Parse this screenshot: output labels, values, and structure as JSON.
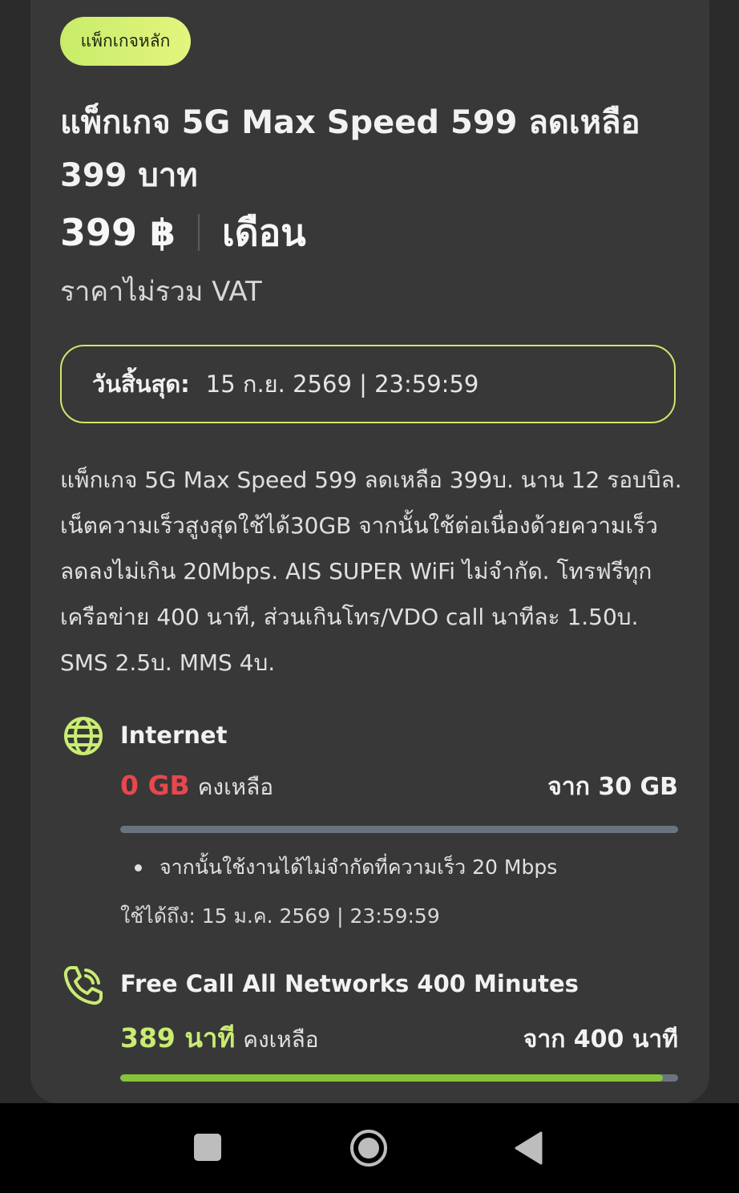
{
  "package": {
    "badge": "แพ็กเกจหลัก",
    "title": "แพ็กเกจ 5G Max Speed 599 ลดเหลือ 399 บาท",
    "price": "399 ฿",
    "period": "เดือน",
    "vat_note": "ราคาไม่รวม VAT",
    "expiry_label": "วันสิ้นสุด:",
    "expiry_value": "15 ก.ย. 2569 | 23:59:59",
    "description": "แพ็กเกจ 5G Max Speed 599 ลดเหลือ 399บ. นาน 12 รอบบิล. เน็ตความเร็วสูงสุดใช้ได้30GB จากนั้นใช้ต่อเนื่องด้วยความเร็วลดลงไม่เกิน 20Mbps. AIS SUPER WiFi ไม่จำกัด. โทรฟรีทุกเครือข่าย 400 นาที, ส่วนเกินโทร/VDO call นาทีละ 1.50บ. SMS 2.5บ. MMS 4บ."
  },
  "internet": {
    "icon": "globe-icon",
    "title": "Internet",
    "remaining_value": "0 GB",
    "remaining_label": "คงเหลือ",
    "total": "จาก 30 GB",
    "fill_fraction": 0,
    "note": "จากนั้นใช้งานได้ไม่จำกัดที่ความเร็ว 20 Mbps",
    "valid_until": "ใช้ได้ถึง: 15 ม.ค. 2569 | 23:59:59"
  },
  "call": {
    "icon": "phone-call-icon",
    "title": "Free Call All Networks 400 Minutes",
    "remaining_value": "389 นาที",
    "remaining_label": "คงเหลือ",
    "total": "จาก 400 นาที",
    "fill_fraction": 0.9725
  },
  "colors": {
    "accent": "#c8ec6a",
    "remaining_zero": "#e8474c",
    "remaining_ok": "#c9ec72",
    "card_bg": "#383838",
    "page_bg": "#2b2b2b",
    "bar_fill": "#86c33a",
    "bar_track": "#6c7380"
  },
  "navbar": {
    "recents": "recents-square-icon",
    "home": "home-circle-icon",
    "back": "back-triangle-icon"
  }
}
